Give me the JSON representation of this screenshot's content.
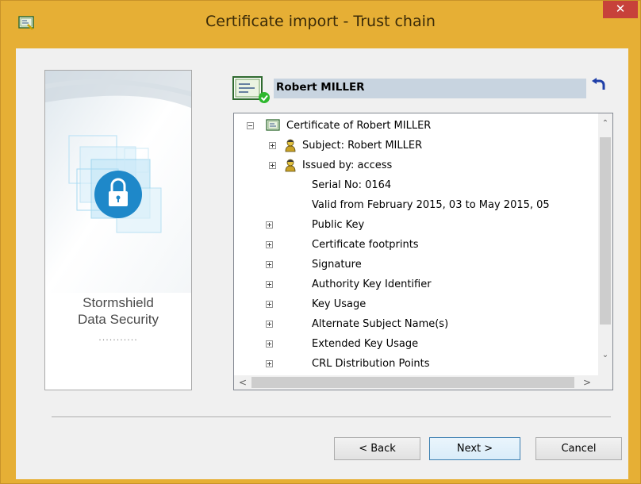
{
  "window": {
    "title": "Certificate import - Trust chain",
    "close_label": "✕",
    "app_icon": "certificate-app-icon"
  },
  "brand": {
    "line1": "Stormshield",
    "line2": "Data Security",
    "dots": "...........",
    "icon": "lock-icon"
  },
  "certificate": {
    "name": "Robert MILLER",
    "icon": "certificate-valid-icon"
  },
  "tree": {
    "root": "Certificate of Robert MILLER",
    "items": [
      {
        "label": "Subject: Robert MILLER",
        "icon": "person-icon",
        "expandable": true
      },
      {
        "label": "Issued by: access",
        "icon": "person-icon",
        "expandable": true
      },
      {
        "label": "Serial No: 0164",
        "icon": "",
        "expandable": false
      },
      {
        "label": "Valid from February 2015, 03 to May 2015, 05",
        "icon": "",
        "expandable": false
      },
      {
        "label": "Public Key",
        "icon": "",
        "expandable": true
      },
      {
        "label": "Certificate footprints",
        "icon": "",
        "expandable": true
      },
      {
        "label": "Signature",
        "icon": "",
        "expandable": true
      },
      {
        "label": "Authority Key Identifier",
        "icon": "",
        "expandable": true
      },
      {
        "label": "Key Usage",
        "icon": "",
        "expandable": true
      },
      {
        "label": "Alternate Subject Name(s)",
        "icon": "",
        "expandable": true
      },
      {
        "label": "Extended Key Usage",
        "icon": "",
        "expandable": true
      },
      {
        "label": "CRL Distribution Points",
        "icon": "",
        "expandable": true
      }
    ]
  },
  "scroll": {
    "up": "⌃",
    "down": "⌄",
    "left": "<",
    "right": ">"
  },
  "buttons": {
    "back": "< Back",
    "next": "Next >",
    "cancel": "Cancel"
  },
  "colors": {
    "title_bar": "#e6af35",
    "close_button": "#c7413a",
    "header_bar": "#c8d4e0",
    "brand_blue": "#1e88c9"
  }
}
